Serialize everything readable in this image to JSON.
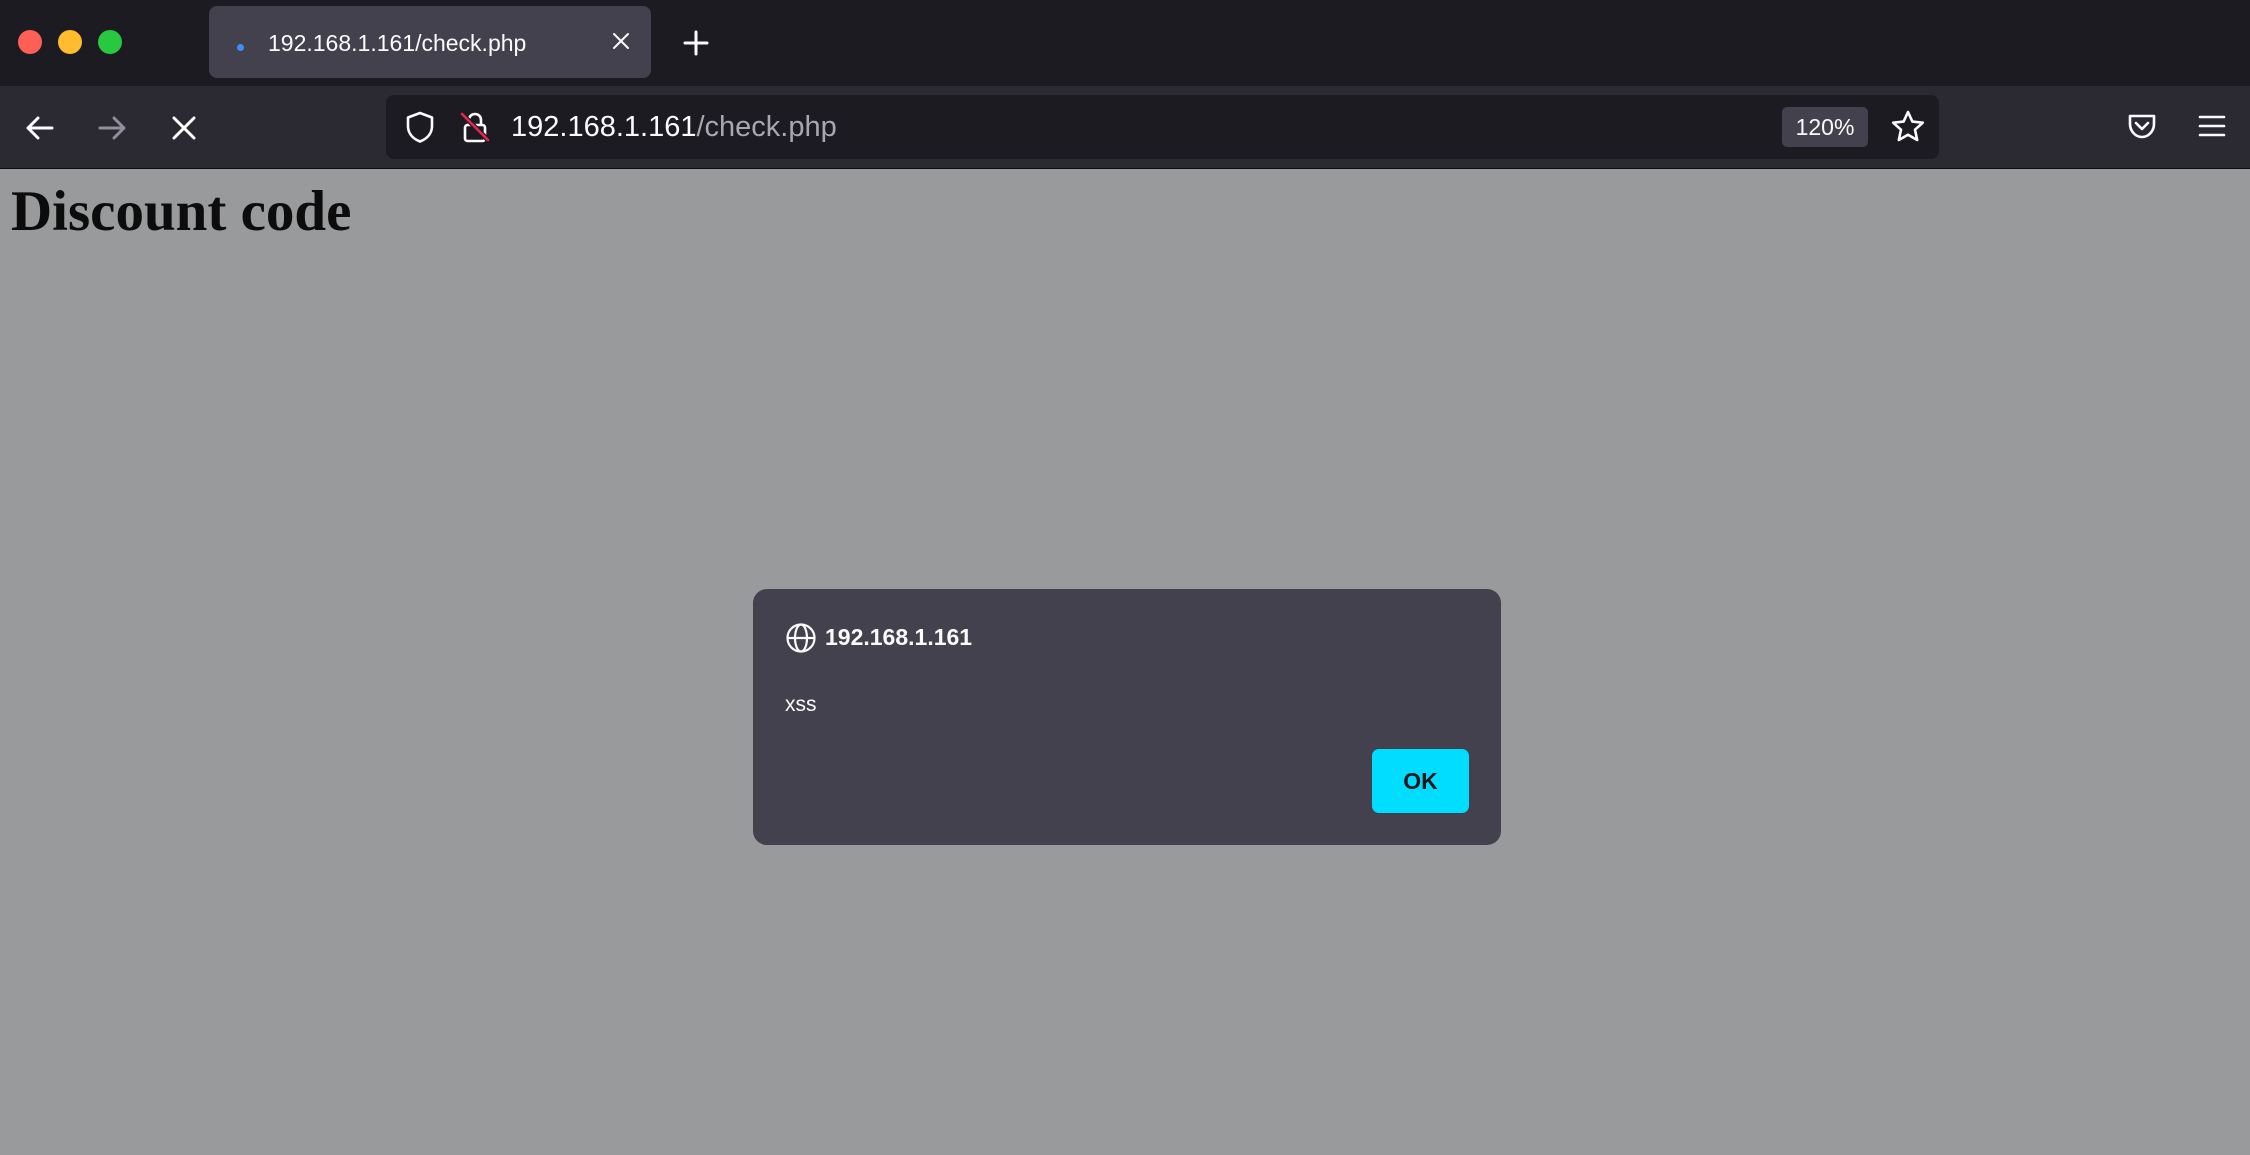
{
  "browser": {
    "tab": {
      "title": "192.168.1.161/check.php"
    },
    "url": {
      "host": "192.168.1.161",
      "path": "/check.php"
    },
    "zoom": "120%",
    "icons": {
      "back": "arrow-left-icon",
      "forward": "arrow-right-icon",
      "stop": "close-icon",
      "shield": "shield-icon",
      "lock": "lock-slash-icon",
      "bookmark": "star-icon",
      "pocket": "pocket-icon",
      "menu": "hamburger-menu-icon",
      "new_tab": "plus-icon"
    }
  },
  "page": {
    "heading": "Discount code"
  },
  "dialog": {
    "origin": "192.168.1.161",
    "message": "xss",
    "ok_label": "OK",
    "icon": "globe-icon"
  },
  "colors": {
    "accent": "#00ddff",
    "toolbar": "#2b2a33",
    "tabstrip": "#1c1b22",
    "dialog": "#42414d",
    "overlay": "#999a9b"
  }
}
